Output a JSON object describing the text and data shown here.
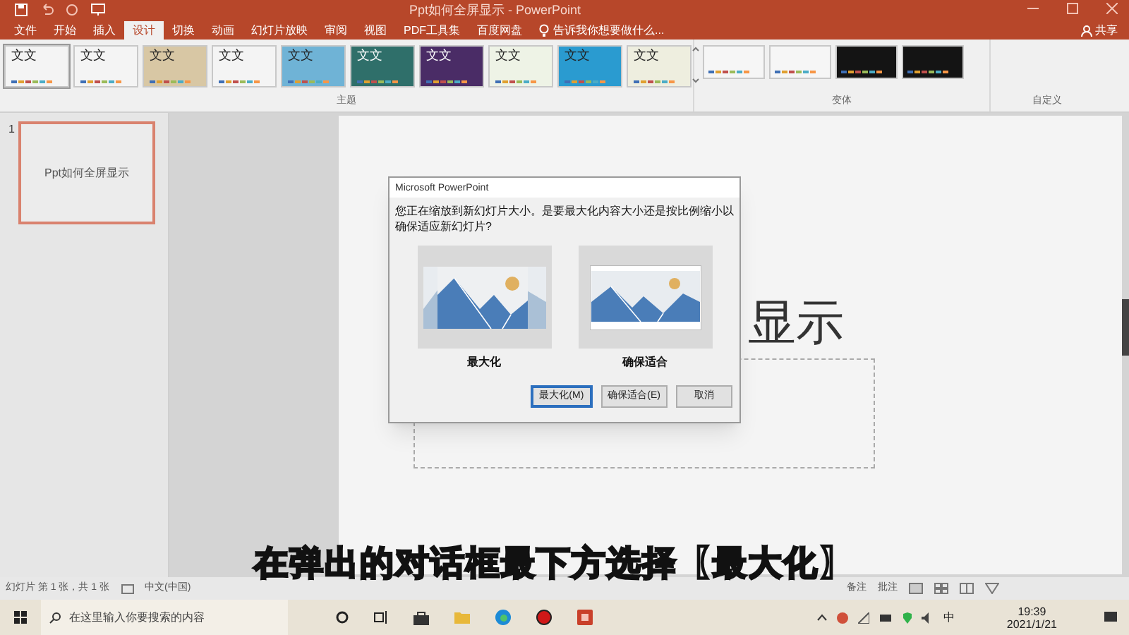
{
  "window": {
    "title": "Ppt如何全屏显示 - PowerPoint",
    "share": "共享"
  },
  "ribbon_tabs": [
    {
      "label": "文件",
      "selected": false
    },
    {
      "label": "开始",
      "selected": false
    },
    {
      "label": "插入",
      "selected": false
    },
    {
      "label": "设计",
      "selected": true
    },
    {
      "label": "切换",
      "selected": false
    },
    {
      "label": "动画",
      "selected": false
    },
    {
      "label": "幻灯片放映",
      "selected": false
    },
    {
      "label": "审阅",
      "selected": false
    },
    {
      "label": "视图",
      "selected": false
    },
    {
      "label": "PDF工具集",
      "selected": false
    },
    {
      "label": "百度网盘",
      "selected": false
    }
  ],
  "tell_me": "告诉我你想要做什么...",
  "themes": {
    "label": "主题",
    "items": [
      {
        "text": "文文",
        "color": "#f4f4f4"
      },
      {
        "text": "文文",
        "color": "#f4f4f4"
      },
      {
        "text": "文文",
        "color": "#d8c7a4"
      },
      {
        "text": "文文",
        "color": "#f4f4f4"
      },
      {
        "text": "文文",
        "color": "#6fb3d6"
      },
      {
        "text": "文文",
        "color": "#2f6f6a"
      },
      {
        "text": "文文",
        "color": "#4a2c66"
      },
      {
        "text": "文文",
        "color": "#eef3e6"
      },
      {
        "text": "文文",
        "color": "#2a9bd0"
      },
      {
        "text": "文文",
        "color": "#eeeedf"
      }
    ]
  },
  "variants": {
    "label": "变体",
    "items": [
      {
        "color": "#f6f6f6"
      },
      {
        "color": "#f6f6f6"
      },
      {
        "color": "#141414"
      },
      {
        "color": "#141414"
      }
    ]
  },
  "customize_label": "自定义",
  "slides_panel": [
    {
      "number": "1",
      "title": "Ppt如何全屏显示",
      "selected": true
    }
  ],
  "slide": {
    "title": "显示"
  },
  "dialog": {
    "title": "Microsoft PowerPoint",
    "message": "您正在缩放到新幻灯片大小。是要最大化内容大小还是按比例缩小以确保适应新幻灯片?",
    "options": [
      {
        "label": "最大化",
        "kind": "maximize"
      },
      {
        "label": "确保适合",
        "kind": "fit"
      }
    ],
    "buttons": [
      {
        "label": "最大化(M)",
        "default": true
      },
      {
        "label": "确保适合(E)",
        "default": false
      },
      {
        "label": "取消",
        "default": false
      }
    ]
  },
  "caption": "在弹出的对话框最下方选择【最大化】",
  "status_bar": {
    "slide_info": "幻灯片 第 1 张，共 1 张",
    "language": "中文(中国)",
    "notes": "备注",
    "comments": "批注"
  },
  "taskbar": {
    "search_placeholder": "在这里输入你要搜索的内容",
    "ime": "中",
    "time": "19:39",
    "date": "2021/1/21"
  }
}
